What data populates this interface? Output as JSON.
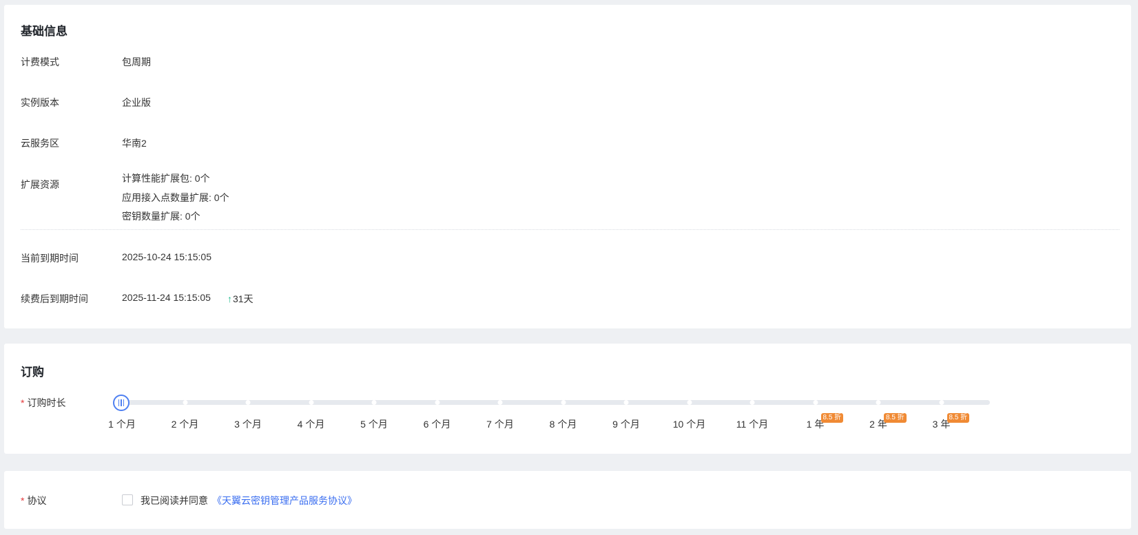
{
  "basic": {
    "title": "基础信息",
    "billing_mode_label": "计费模式",
    "billing_mode_value": "包周期",
    "edition_label": "实例版本",
    "edition_value": "企业版",
    "region_label": "云服务区",
    "region_value": "华南2",
    "ext_label": "扩展资源",
    "ext_items": [
      "计算性能扩展包: 0个",
      "应用接入点数量扩展: 0个",
      "密钥数量扩展: 0个"
    ],
    "current_expiry_label": "当前到期时间",
    "current_expiry_value": "2025-10-24 15:15:05",
    "renew_expiry_label": "续费后到期时间",
    "renew_expiry_value": "2025-11-24 15:15:05",
    "renew_delta": "31天"
  },
  "order": {
    "title": "订购",
    "required_mark": "*",
    "duration_label": "订购时长",
    "selected_index": 0,
    "options": [
      "1 个月",
      "2 个月",
      "3 个月",
      "4 个月",
      "5 个月",
      "6 个月",
      "7 个月",
      "8 个月",
      "9 个月",
      "10 个月",
      "11 个月",
      "1 年",
      "2 年",
      "3 年"
    ],
    "discount_badge": "8.5 折"
  },
  "agreement": {
    "required_mark": "*",
    "label": "协议",
    "checkbox_checked": false,
    "text": "我已阅读并同意",
    "link_text": "《天翼云密钥管理产品服务协议》"
  },
  "colors": {
    "accent": "#4d7ff1",
    "link": "#3a6ef0",
    "badge": "#f08a34",
    "up_arrow": "#19b98a",
    "required": "#e4393c"
  }
}
